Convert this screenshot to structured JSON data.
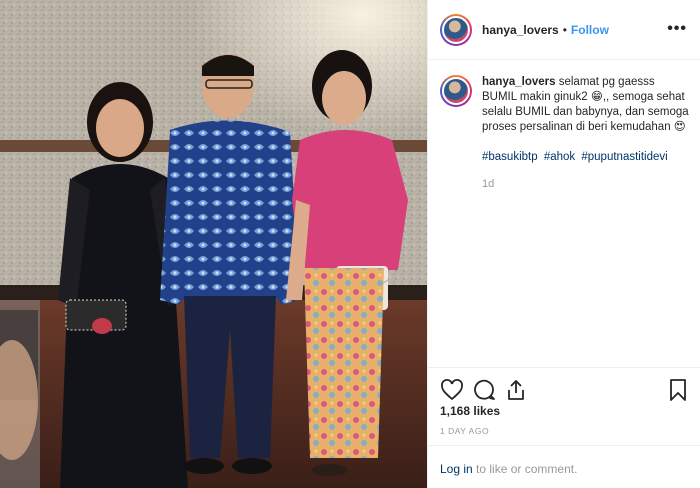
{
  "post": {
    "username": "hanya_lovers",
    "separator": "•",
    "follow_label": "Follow",
    "more_icon": "more-horizontal-icon",
    "caption": {
      "username": "hanya_lovers",
      "text": "selamat pg gaesss BUMIL makin ginuk2 😁,, semoga sehat selalu BUMIL dan babynya, dan semoga proses persalinan di beri kemudahan 😍",
      "hashtags": [
        "#basukibtp",
        "#ahok",
        "#puputnastitidevi"
      ],
      "time": "1d"
    },
    "actions": {
      "like_icon": "heart-icon",
      "comment_icon": "comment-icon",
      "share_icon": "share-icon",
      "save_icon": "bookmark-icon"
    },
    "likes": "1,168 likes",
    "posted_ago": "1 DAY AGO",
    "comment_bar": {
      "login_label": "Log in",
      "rest_text": " to like or comment."
    }
  },
  "colors": {
    "link_blue": "#3897f0",
    "hashtag_blue": "#003569",
    "muted_gray": "#999999",
    "border": "#efefef"
  }
}
